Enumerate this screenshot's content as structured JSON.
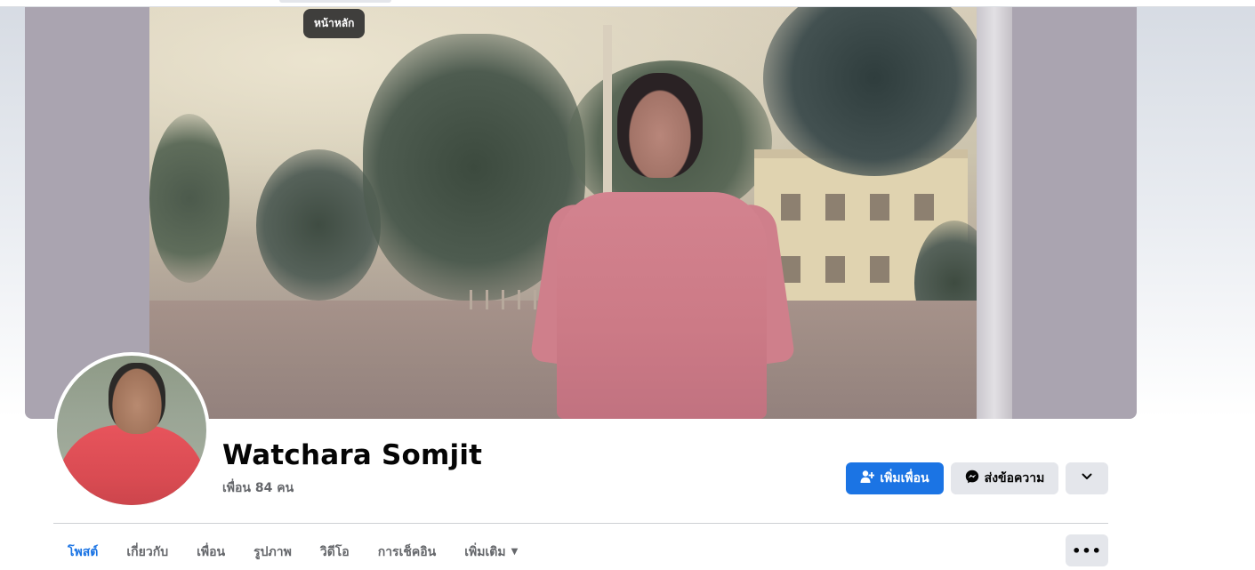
{
  "tooltip": {
    "text": "หน้าหลัก"
  },
  "profile": {
    "name": "Watchara Somjit",
    "friends_count": "เพื่อน 84 คน"
  },
  "actions": {
    "add_friend_label": "เพิ่มเพื่อน",
    "message_label": "ส่งข้อความ",
    "add_friend_icon": "add-person-icon",
    "message_icon": "messenger-icon",
    "dropdown_icon": "chevron-down-icon"
  },
  "tabs": [
    {
      "label": "โพสต์",
      "active": true
    },
    {
      "label": "เกี่ยวกับ",
      "active": false
    },
    {
      "label": "เพื่อน",
      "active": false
    },
    {
      "label": "รูปภาพ",
      "active": false
    },
    {
      "label": "วิดีโอ",
      "active": false
    },
    {
      "label": "การเช็คอิน",
      "active": false
    },
    {
      "label": "เพิ่มเติม",
      "active": false
    }
  ],
  "colors": {
    "accent": "#1b74e4",
    "secondary_button": "#e4e6eb",
    "text_secondary": "#65676b"
  }
}
